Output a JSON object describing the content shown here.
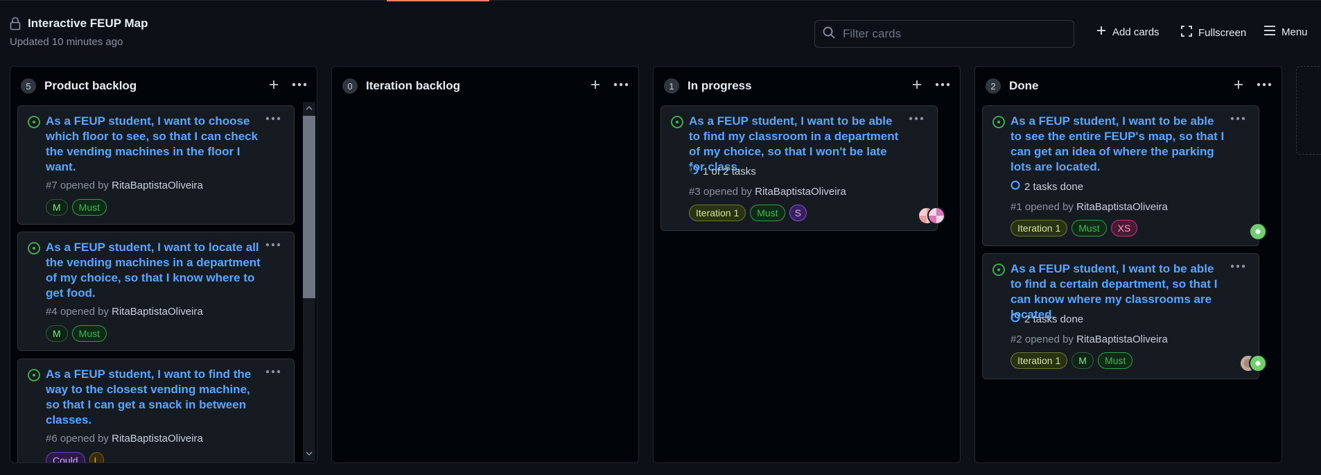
{
  "project": {
    "title": "Interactive FEUP Map",
    "updated": "Updated 10 minutes ago"
  },
  "filter": {
    "placeholder": "Filter cards",
    "value": ""
  },
  "actions": {
    "add_cards": "Add cards",
    "fullscreen": "Fullscreen",
    "menu": "Menu"
  },
  "icons": [
    "lock-icon",
    "search-icon",
    "plus-icon",
    "fullscreen-icon",
    "menu-icon",
    "kebab-icon",
    "open-issue-icon",
    "task-progress-icon"
  ],
  "colors": {
    "background": "#0d1117",
    "column": "#010409",
    "card": "#161b22",
    "link": "#58a6ff",
    "open": "#3fb950",
    "accent": "#f78166"
  },
  "columns": [
    {
      "name": "Product backlog",
      "count": "5",
      "cards": [
        {
          "title": "As a FEUP student, I want to choose which floor to see, so that I can check the vending machines in the floor I want.",
          "number": "#7",
          "opened_by": "opened by",
          "author": "RitaBaptistaOliveira",
          "labels": [
            "M",
            "Must"
          ]
        },
        {
          "title": "As a FEUP student, I want to locate all the vending machines in a department of my choice, so that I know where to get food.",
          "number": "#4",
          "opened_by": "opened by",
          "author": "RitaBaptistaOliveira",
          "labels": [
            "M",
            "Must"
          ]
        },
        {
          "title": "As a FEUP student, I want to find the way to the closest vending machine, so that I can get a snack in between classes.",
          "number": "#6",
          "opened_by": "opened by",
          "author": "RitaBaptistaOliveira",
          "labels": [
            "Could",
            "L"
          ]
        }
      ]
    },
    {
      "name": "Iteration backlog",
      "count": "0",
      "cards": []
    },
    {
      "name": "In progress",
      "count": "1",
      "cards": [
        {
          "title": "As a FEUP student, I want to be able to find my classroom in a department of my choice, so that I won't be late for class.",
          "tasks": "1 of 2 tasks",
          "tasks_fraction": 0.5,
          "number": "#3",
          "opened_by": "opened by",
          "author": "RitaBaptistaOliveira",
          "labels": [
            "Iteration 1",
            "Must",
            "S"
          ]
        }
      ]
    },
    {
      "name": "Done",
      "count": "2",
      "cards": [
        {
          "title": "As a FEUP student, I want to be able to see the entire FEUP's map, so that I can get an idea of where the parking lots are located.",
          "tasks": "2 tasks done",
          "number": "#1",
          "opened_by": "opened by",
          "author": "RitaBaptistaOliveira",
          "labels": [
            "Iteration 1",
            "Must",
            "XS"
          ]
        },
        {
          "title": "As a FEUP student, I want to be able to find a certain department, so that I can know where my classrooms are located.",
          "tasks": "2 tasks done",
          "number": "#2",
          "opened_by": "opened by",
          "author": "RitaBaptistaOliveira",
          "labels": [
            "Iteration 1",
            "M",
            "Must"
          ]
        }
      ]
    }
  ]
}
